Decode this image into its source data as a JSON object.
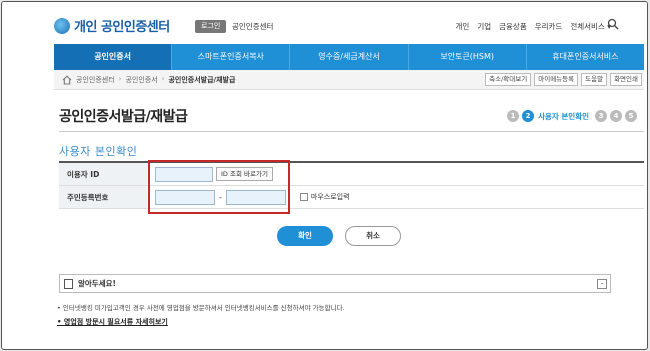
{
  "header": {
    "logo_text": "개인 공인인증센터",
    "login_label": "로그인",
    "center_label": "공인인증센터",
    "links": [
      "개인",
      "기업",
      "금융상품",
      "우리카드",
      "전체서비스 ▾"
    ]
  },
  "nav": {
    "items": [
      {
        "label": "공인인증서",
        "active": true
      },
      {
        "label": "스마트폰인증서복사",
        "active": false
      },
      {
        "label": "영수증/세금계산서",
        "active": false
      },
      {
        "label": "보안토큰(HSM)",
        "active": false
      },
      {
        "label": "휴대폰인증서서비스",
        "active": false
      }
    ]
  },
  "breadcrumb": {
    "items": [
      "공인인증센터",
      "공인인증서",
      "공인인증서발급/재발급"
    ],
    "separator": "›",
    "tools": [
      "축소/확대보기",
      "마이메뉴등록",
      "도움말",
      "화면인쇄"
    ]
  },
  "page": {
    "title": "공인인증서발급/재발급",
    "steps": [
      "1",
      "2",
      "3",
      "4",
      "5"
    ],
    "active_step_label": "사용자 본인확인",
    "section_title": "사용자 본인확인"
  },
  "form": {
    "user_id_label": "이용자 ID",
    "id_lookup_button": "ID 조회 바로가기",
    "resident_label": "주민등록번호",
    "dash": "-",
    "mouse_input_label": "마우스로입력"
  },
  "actions": {
    "confirm": "확인",
    "cancel": "취소"
  },
  "notice": {
    "title": "알아두세요!",
    "collapse": "-",
    "text": "• 인터넷뱅킹 미가입고객인 경우 사전에 영업점을 방문하셔서 인터넷뱅킹서비스를 신청하셔야 가능합니다.",
    "link": "• 영업점 방문시 필요서류 자세히보기"
  },
  "colors": {
    "primary": "#1f8fd6",
    "highlight": "#c62828"
  }
}
